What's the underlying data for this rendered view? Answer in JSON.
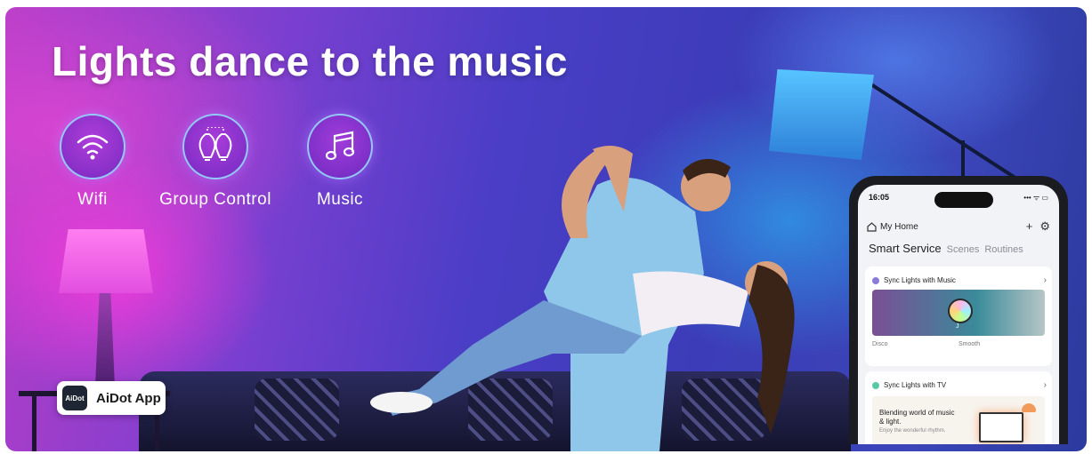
{
  "headline": "Lights dance to the music",
  "features": [
    {
      "label": "Wifi",
      "icon": "wifi-icon"
    },
    {
      "label": "Group Control",
      "icon": "bulbs-icon"
    },
    {
      "label": "Music",
      "icon": "music-note-icon"
    }
  ],
  "app_badge": {
    "logo_text": "AiDot",
    "label": "AiDot App"
  },
  "phone": {
    "status_time": "16:05",
    "status_icons": "••• ᯤ ▭",
    "home_title": "My Home",
    "home_actions": {
      "add": "+",
      "settings": "⚙"
    },
    "tabs": [
      "Smart Service",
      "Scenes",
      "Routines"
    ],
    "cards": [
      {
        "title": "Sync Lights with Music",
        "modes": [
          "Disco",
          "Smooth"
        ],
        "chevron": "›",
        "dot_color": "#8c7bd6",
        "disc_caption": "J"
      },
      {
        "title": "Sync Lights with TV",
        "subtitle": "Blending world of music & light.",
        "caption": "Enjoy the wonderful rhythm.",
        "chevron": "›",
        "dot_color": "#5ac8a8"
      }
    ]
  },
  "colors": {
    "accent_ring": "#96dcff",
    "badge_bg": "#ffffff",
    "headline": "#ffffff"
  }
}
